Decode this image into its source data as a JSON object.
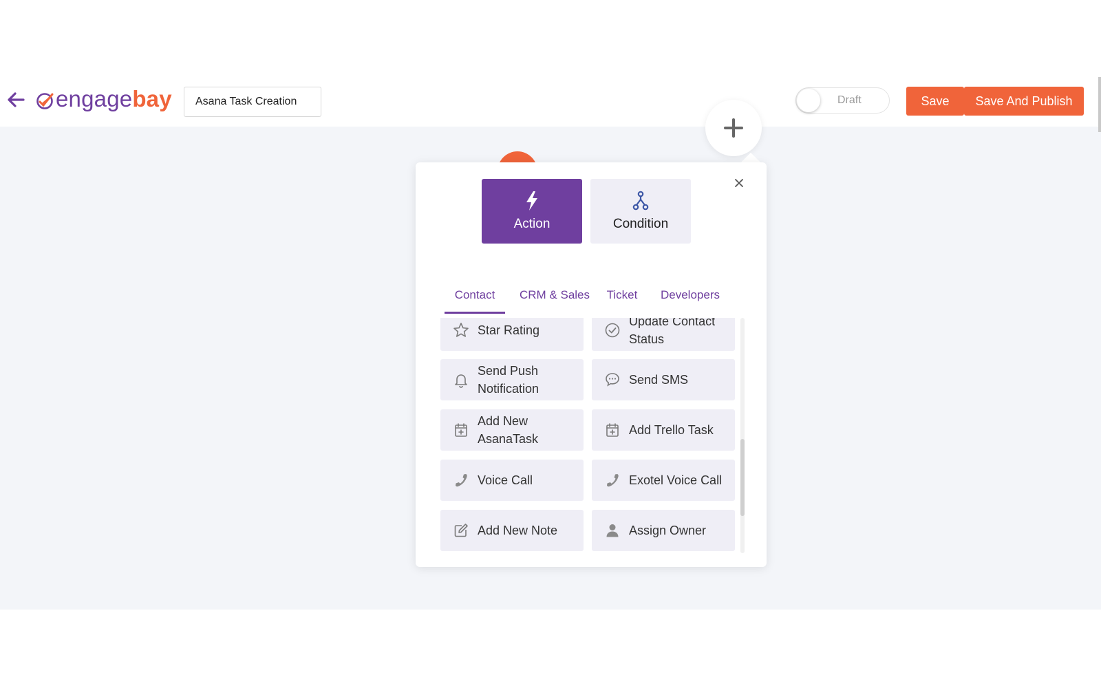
{
  "header": {
    "back_icon": "arrow-left-icon",
    "logo": {
      "part1": "engage",
      "part2": "bay"
    },
    "workflow_name": "Asana Task Creation",
    "toggle_label": "Draft",
    "save_label": "Save",
    "publish_label": "Save And Publish"
  },
  "colors": {
    "brand_purple": "#6f3f9f",
    "brand_orange": "#f0643a",
    "canvas_bg": "#f3f5f9",
    "item_bg": "#efeef6"
  },
  "popup": {
    "type_cards": [
      {
        "label": "Action",
        "icon": "lightning-icon",
        "selected": true
      },
      {
        "label": "Condition",
        "icon": "branch-icon",
        "selected": false
      }
    ],
    "tabs": [
      {
        "label": "Contact",
        "active": true
      },
      {
        "label": "CRM & Sales",
        "active": false
      },
      {
        "label": "Ticket",
        "active": false
      },
      {
        "label": "Developers",
        "active": false
      }
    ],
    "items": [
      {
        "label": "Star Rating",
        "icon": "star-icon"
      },
      {
        "label": "Update Contact Status",
        "icon": "check-circle-icon"
      },
      {
        "label": "Send Push Notification",
        "icon": "bell-icon"
      },
      {
        "label": "Send SMS",
        "icon": "chat-bubble-icon"
      },
      {
        "label": "Add New AsanaTask",
        "icon": "calendar-plus-icon"
      },
      {
        "label": "Add Trello Task",
        "icon": "calendar-plus-icon"
      },
      {
        "label": "Voice Call",
        "icon": "phone-icon"
      },
      {
        "label": "Exotel Voice Call",
        "icon": "phone-icon"
      },
      {
        "label": "Add New Note",
        "icon": "edit-note-icon"
      },
      {
        "label": "Assign Owner",
        "icon": "user-icon"
      }
    ]
  }
}
